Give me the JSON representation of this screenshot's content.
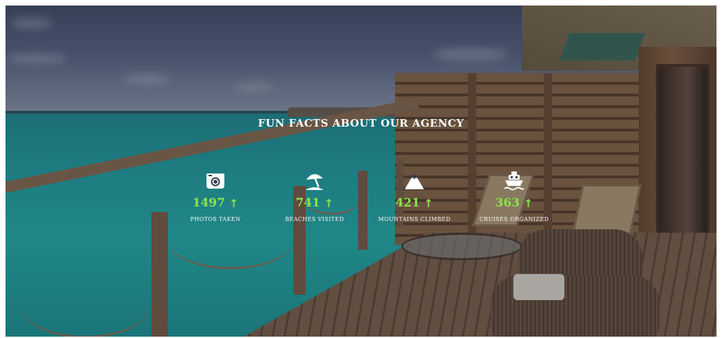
{
  "section": {
    "title": "FUN FACTS ABOUT OUR AGENCY"
  },
  "stats": [
    {
      "icon": "camera-icon",
      "value": "1497",
      "trend": "↑",
      "label": "PHOTOS TAKEN"
    },
    {
      "icon": "beach-umbrella-icon",
      "value": "741",
      "trend": "↑",
      "label": "BEACHES VISITED"
    },
    {
      "icon": "mountain-icon",
      "value": "421",
      "trend": "↑",
      "label": "MOUNTAINS CLIMBED"
    },
    {
      "icon": "cruise-ship-icon",
      "value": "363",
      "trend": "↑",
      "label": "CRUISES ORGANIZED"
    }
  ],
  "colors": {
    "accent": "#8ee54a",
    "text": "#ffffff"
  }
}
